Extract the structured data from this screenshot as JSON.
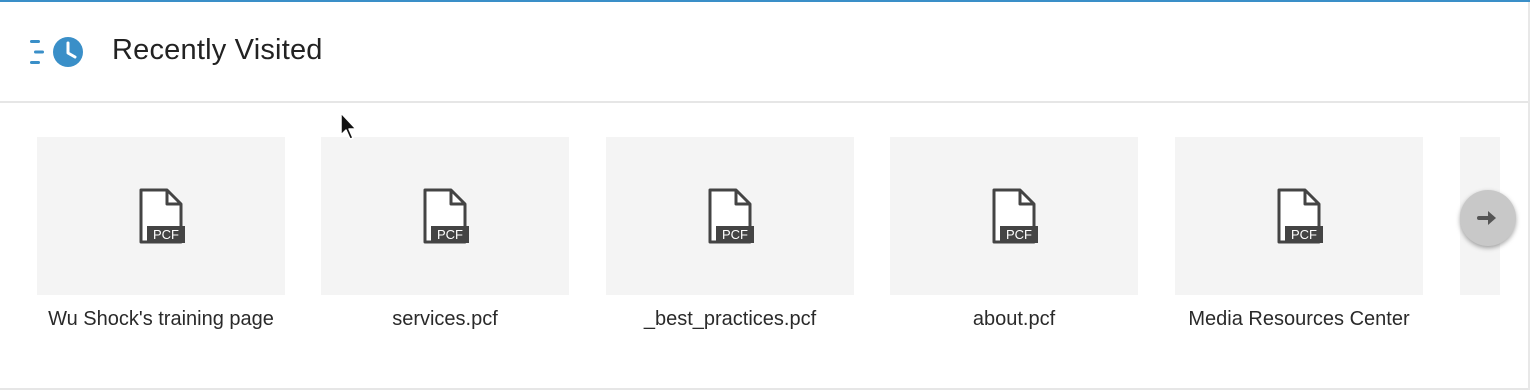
{
  "header": {
    "title": "Recently Visited",
    "icon": "recent-history-icon",
    "accent_color": "#3a8fc8"
  },
  "cards": [
    {
      "label": "Wu Shock's training page",
      "badge": "PCF",
      "icon": "pcf-file-icon"
    },
    {
      "label": "services.pcf",
      "badge": "PCF",
      "icon": "pcf-file-icon"
    },
    {
      "label": "_best_practices.pcf",
      "badge": "PCF",
      "icon": "pcf-file-icon"
    },
    {
      "label": "about.pcf",
      "badge": "PCF",
      "icon": "pcf-file-icon"
    },
    {
      "label": "Media Resources Center",
      "badge": "PCF",
      "icon": "pcf-file-icon"
    }
  ],
  "navigation": {
    "next_icon": "arrow-right-icon"
  }
}
